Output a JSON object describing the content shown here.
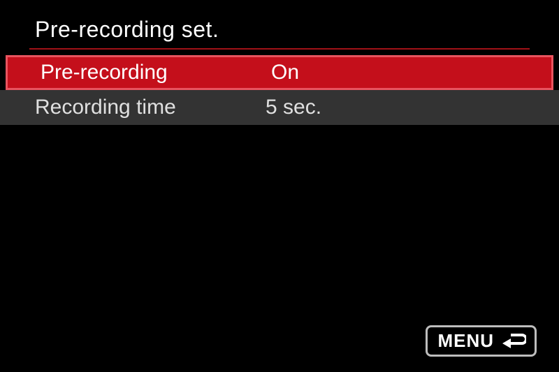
{
  "title": "Pre-recording set.",
  "items": [
    {
      "label": "Pre-recording",
      "value": "On",
      "selected": true
    },
    {
      "label": "Recording time",
      "value": "5 sec.",
      "selected": false
    }
  ],
  "menu_button": {
    "label": "MENU"
  },
  "colors": {
    "accent": "#c40f1b",
    "accent_border": "#e8545f",
    "divider": "#a11217",
    "inactive_bg": "#333333"
  }
}
